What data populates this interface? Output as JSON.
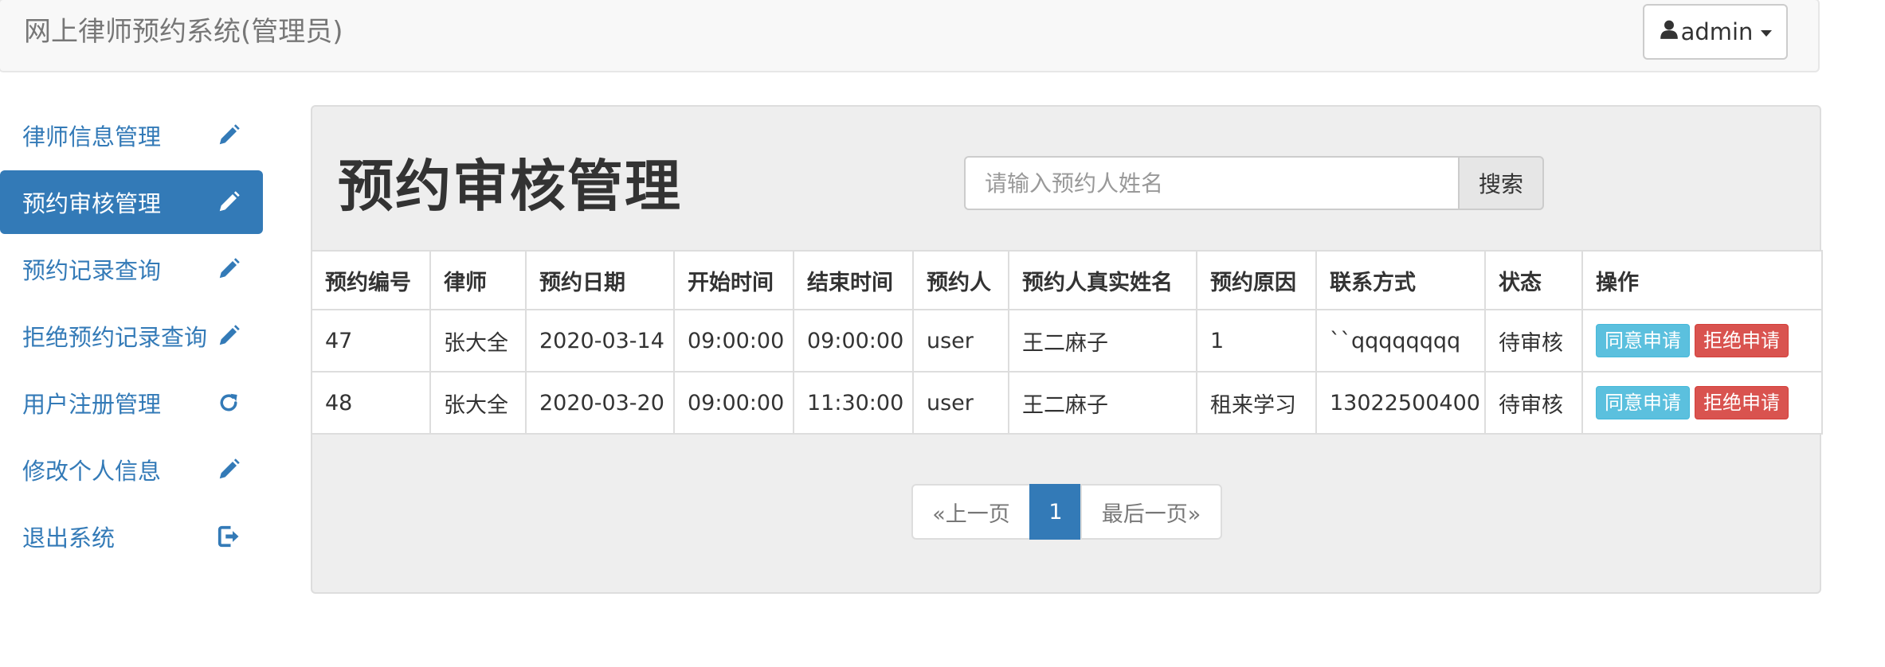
{
  "header": {
    "brand": "网上律师预约系统(管理员)",
    "user_label": "admin"
  },
  "sidebar": {
    "items": [
      {
        "label": "律师信息管理",
        "icon": "pencil-icon"
      },
      {
        "label": "预约审核管理",
        "icon": "pencil-icon",
        "active": true
      },
      {
        "label": "预约记录查询",
        "icon": "pencil-icon"
      },
      {
        "label": "拒绝预约记录查询",
        "icon": "pencil-icon"
      },
      {
        "label": "用户注册管理",
        "icon": "refresh-icon"
      },
      {
        "label": "修改个人信息",
        "icon": "pencil-icon"
      },
      {
        "label": "退出系统",
        "icon": "logout-icon"
      }
    ]
  },
  "main": {
    "title": "预约审核管理",
    "search": {
      "placeholder": "请输入预约人姓名",
      "button": "搜索"
    },
    "table": {
      "headers": [
        "预约编号",
        "律师",
        "预约日期",
        "开始时间",
        "结束时间",
        "预约人",
        "预约人真实姓名",
        "预约原因",
        "联系方式",
        "状态",
        "操作"
      ],
      "rows": [
        [
          "47",
          "张大全",
          "2020-03-14",
          "09:00:00",
          "09:00:00",
          "user",
          "王二麻子",
          "1",
          "``qqqqqqqq",
          "待审核"
        ],
        [
          "48",
          "张大全",
          "2020-03-20",
          "09:00:00",
          "11:30:00",
          "user",
          "王二麻子",
          "租来学习",
          "13022500400",
          "待审核"
        ]
      ],
      "actions": {
        "agree": "同意申请",
        "reject": "拒绝申请"
      }
    },
    "pagination": {
      "prev": "«上一页",
      "current": "1",
      "last": "最后一页»"
    }
  },
  "colors": {
    "primary": "#337ab7",
    "info": "#5bc0de",
    "danger": "#d9534f"
  }
}
